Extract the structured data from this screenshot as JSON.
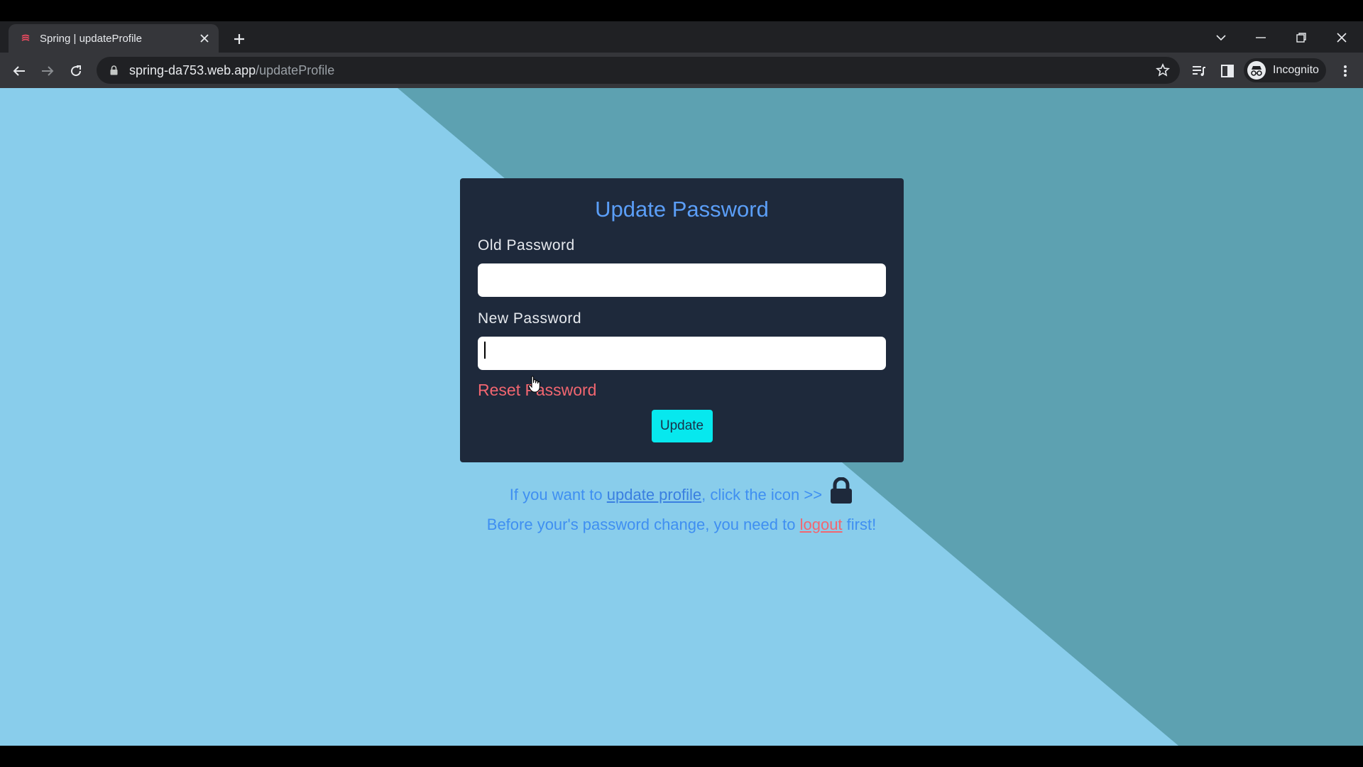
{
  "browser": {
    "tab_title": "Spring | updateProfile",
    "url_host": "spring-da753.web.app",
    "url_path": "/updateProfile",
    "profile_label": "Incognito"
  },
  "form": {
    "title": "Update Password",
    "old_password_label": "Old Password",
    "old_password_value": "",
    "new_password_label": "New Password",
    "new_password_value": "",
    "reset_link": "Reset Password",
    "update_button": "Update"
  },
  "info": {
    "profile_prefix": "If you want to",
    "profile_link": "update profile",
    "profile_suffix": ", click the icon >>",
    "logout_prefix": "Before your's password change, you need to",
    "logout_link": "logout",
    "logout_suffix": "first!"
  },
  "colors": {
    "page_light": "#89cdeb",
    "page_dark": "#5da1b1",
    "card": "#1e293b",
    "title": "#5b9ef7",
    "button": "#07e8ee",
    "reset": "#f26670"
  }
}
